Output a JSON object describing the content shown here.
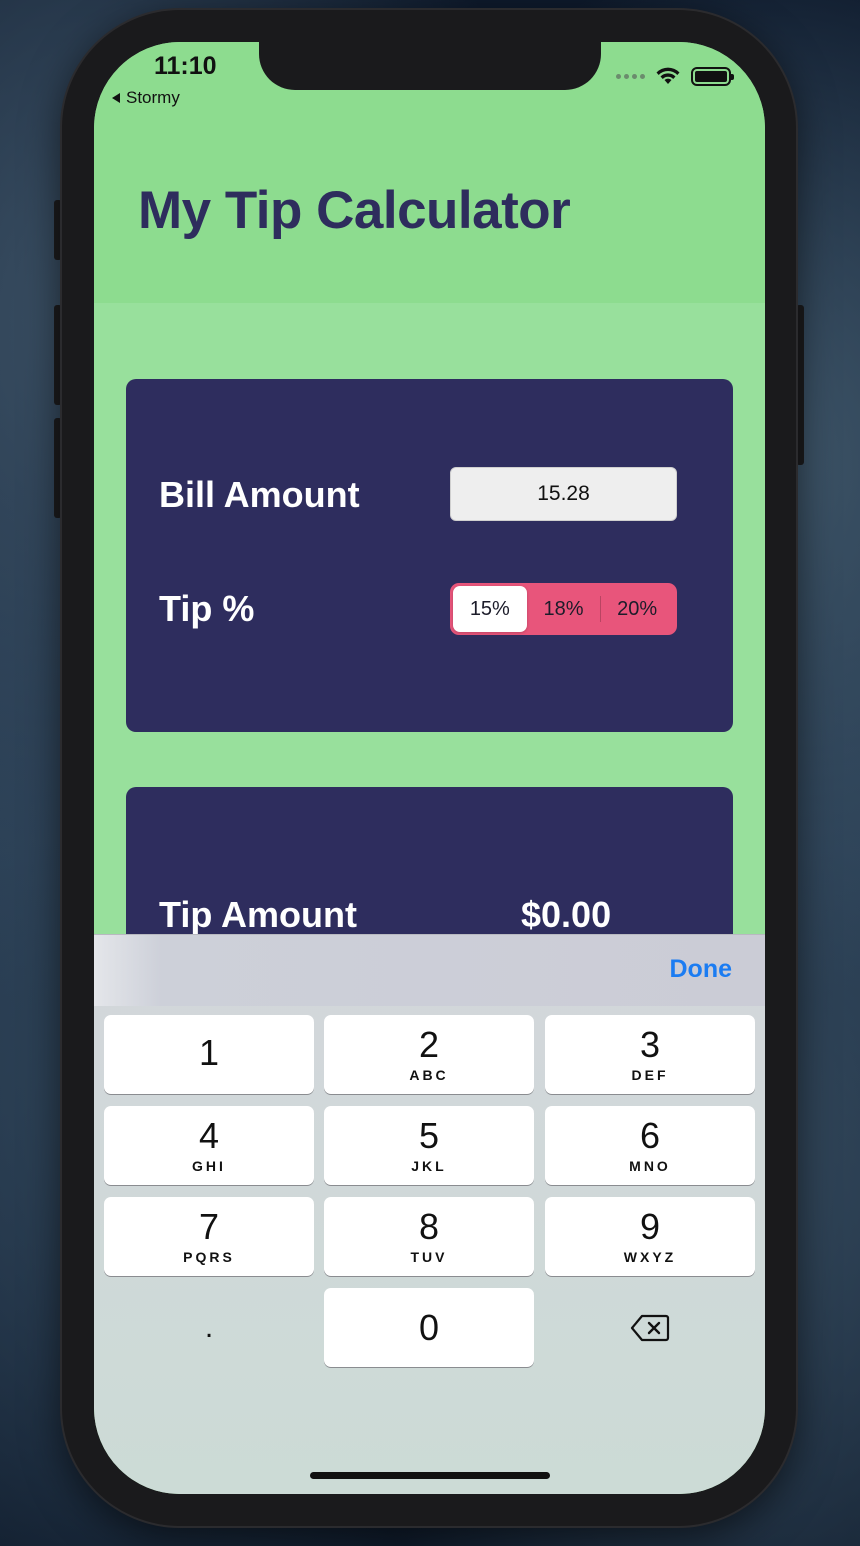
{
  "status_bar": {
    "time": "11:10",
    "back_app": "Stormy"
  },
  "header": {
    "title": "My Tip Calculator"
  },
  "input_card": {
    "bill_label": "Bill Amount",
    "bill_value": "15.28",
    "tip_label": "Tip %",
    "tip_options": [
      "15%",
      "18%",
      "20%"
    ],
    "selected_tip": "15%"
  },
  "result_card": {
    "tip_amount_label": "Tip Amount",
    "tip_amount_value": "$0.00"
  },
  "keyboard": {
    "done_label": "Done",
    "keys": [
      {
        "num": "1",
        "letters": ""
      },
      {
        "num": "2",
        "letters": "ABC"
      },
      {
        "num": "3",
        "letters": "DEF"
      },
      {
        "num": "4",
        "letters": "GHI"
      },
      {
        "num": "5",
        "letters": "JKL"
      },
      {
        "num": "6",
        "letters": "MNO"
      },
      {
        "num": "7",
        "letters": "PQRS"
      },
      {
        "num": "8",
        "letters": "TUV"
      },
      {
        "num": "9",
        "letters": "WXYZ"
      },
      {
        "num": ".",
        "letters": ""
      },
      {
        "num": "0",
        "letters": ""
      }
    ],
    "delete_icon": "backspace-icon"
  },
  "colors": {
    "header_bg": "#8ddc8f",
    "content_bg": "#98e09c",
    "card_bg": "#2e2d5e",
    "title_color": "#2e2d5d",
    "segment_color": "#e8557b",
    "done_color": "#1b7cf2"
  }
}
